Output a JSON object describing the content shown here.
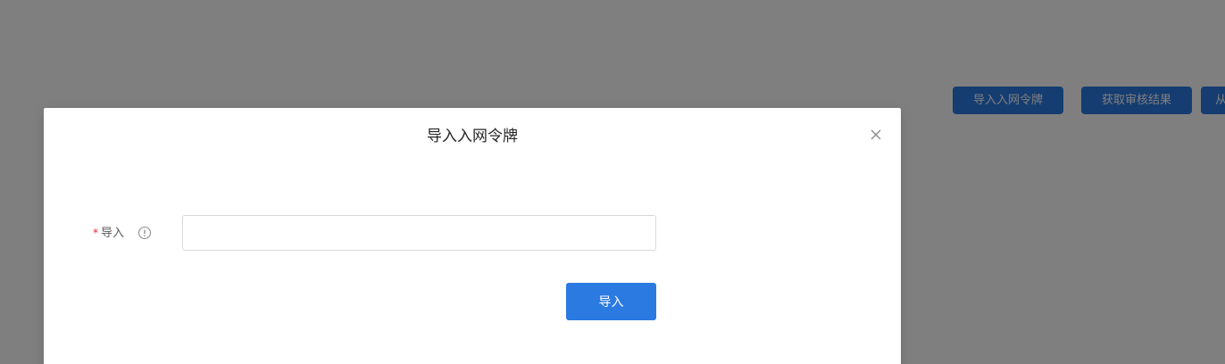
{
  "background": {
    "toolbar": {
      "import_token_label": "导入入网令牌",
      "audit_result_label": "获取审核结果",
      "partial_label": "从"
    }
  },
  "modal": {
    "title": "导入入网令牌",
    "close_icon": "close-icon",
    "form": {
      "required_mark": "*",
      "import_label": "导入",
      "info_icon": "info-circle-icon",
      "input_value": "",
      "input_placeholder": ""
    },
    "submit_label": "导入"
  },
  "colors": {
    "primary": "#2a7ae2",
    "required": "#f5222d",
    "overlay": "rgba(0,0,0,0.5)"
  }
}
